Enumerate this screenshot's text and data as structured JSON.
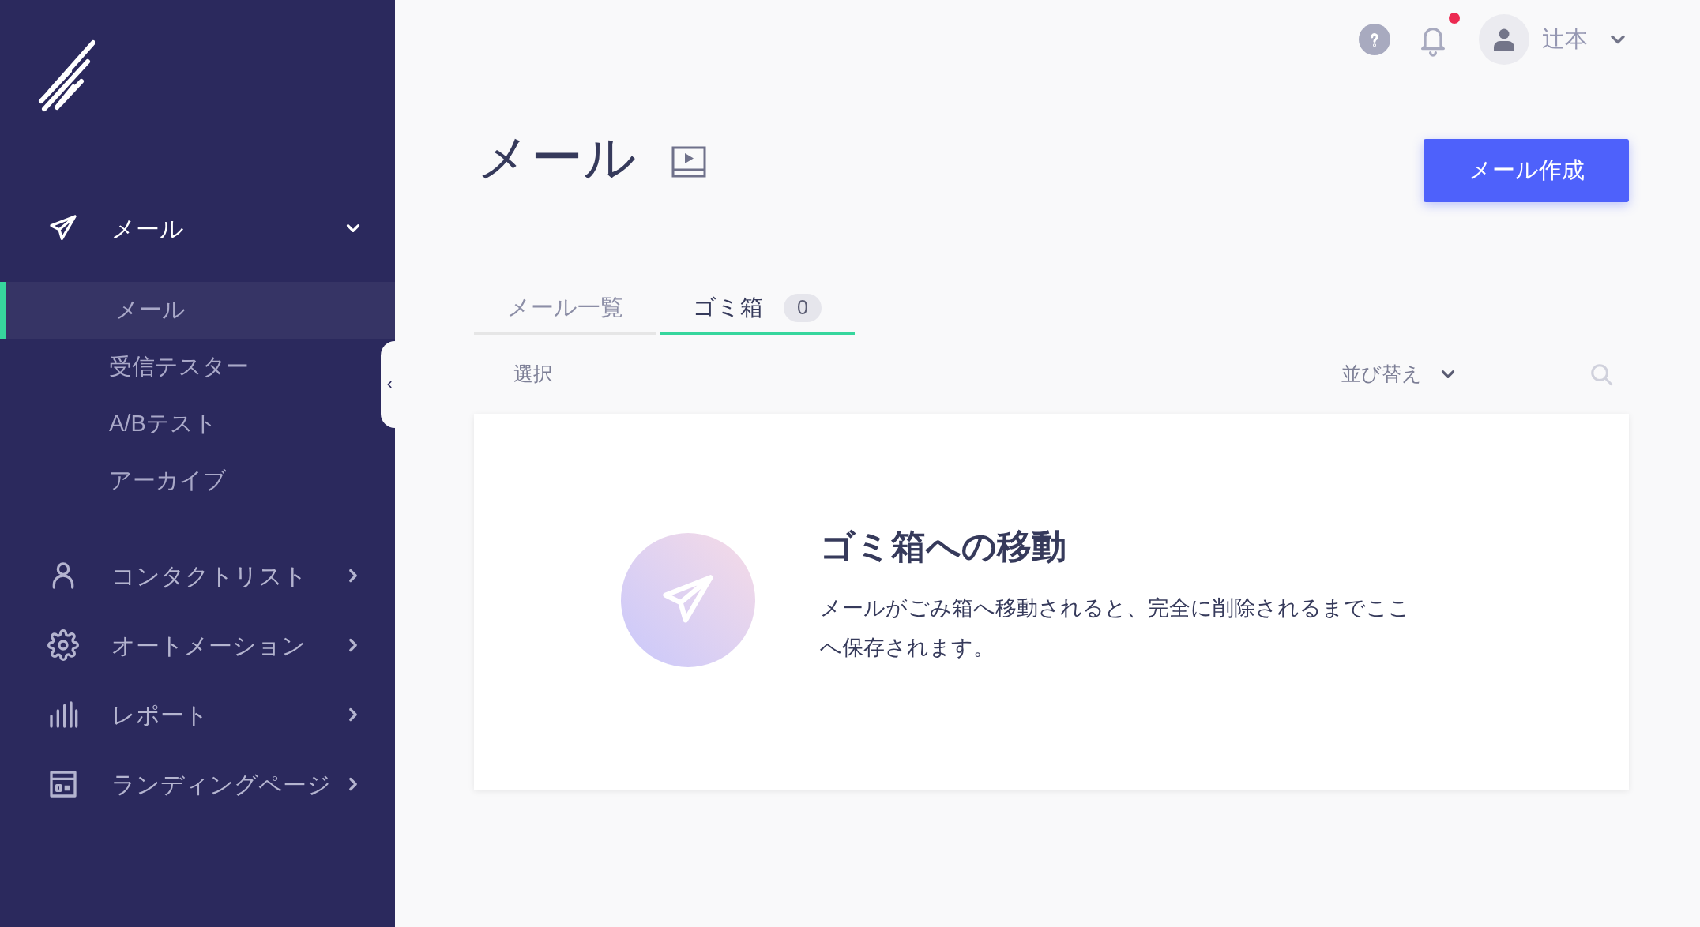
{
  "sidebar": {
    "nav": [
      {
        "label": "メール",
        "expanded": true,
        "children": [
          {
            "label": "メール",
            "selected": true
          },
          {
            "label": "受信テスター",
            "selected": false
          },
          {
            "label": "A/Bテスト",
            "selected": false
          },
          {
            "label": "アーカイブ",
            "selected": false
          }
        ]
      },
      {
        "label": "コンタクトリスト",
        "expanded": false
      },
      {
        "label": "オートメーション",
        "expanded": false
      },
      {
        "label": "レポート",
        "expanded": false
      },
      {
        "label": "ランディングページ",
        "expanded": false
      }
    ]
  },
  "header": {
    "user_name": "辻本",
    "notifications_unread": true
  },
  "page": {
    "title": "メール",
    "primary_button": "メール作成"
  },
  "tabs": [
    {
      "label": "メール一覧",
      "selected": false
    },
    {
      "label": "ゴミ箱",
      "selected": true,
      "count": "0"
    }
  ],
  "toolbar": {
    "select_label": "選択",
    "sort_label": "並び替え"
  },
  "empty_state": {
    "heading": "ゴミ箱への移動",
    "body": "メールがごみ箱へ移動されると、完全に削除されるまでここへ保存されます。"
  }
}
